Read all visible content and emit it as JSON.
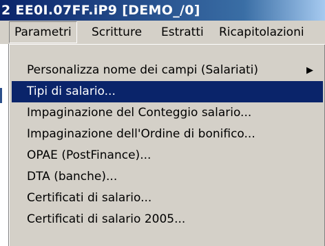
{
  "window": {
    "title": "2 EE0I.07FF.iP9  [DEMO_/0]"
  },
  "menubar": {
    "items": [
      {
        "label": "Parametri"
      },
      {
        "label": "Scritture"
      },
      {
        "label": "Estratti"
      },
      {
        "label": "Ricapitolazioni"
      }
    ]
  },
  "dropdown": {
    "items": [
      {
        "label": "Personalizza nome dei campi (Salariati)",
        "submenu_icon": "submenu-arrow-icon"
      },
      {
        "label": "Tipi di salario...",
        "selected": true
      },
      {
        "label": "Impaginazione del Conteggio salario..."
      },
      {
        "label": "Impaginazione dell'Ordine di bonifico..."
      },
      {
        "label": "OPAE (PostFinance)..."
      },
      {
        "label": "DTA (banche)..."
      },
      {
        "label": "Certificati di salario..."
      },
      {
        "label": "Certificati di salario 2005..."
      }
    ]
  },
  "colors": {
    "title_bar": "#0a246a",
    "highlight": "#0a246a",
    "menu_bg": "#d4d0c8"
  }
}
